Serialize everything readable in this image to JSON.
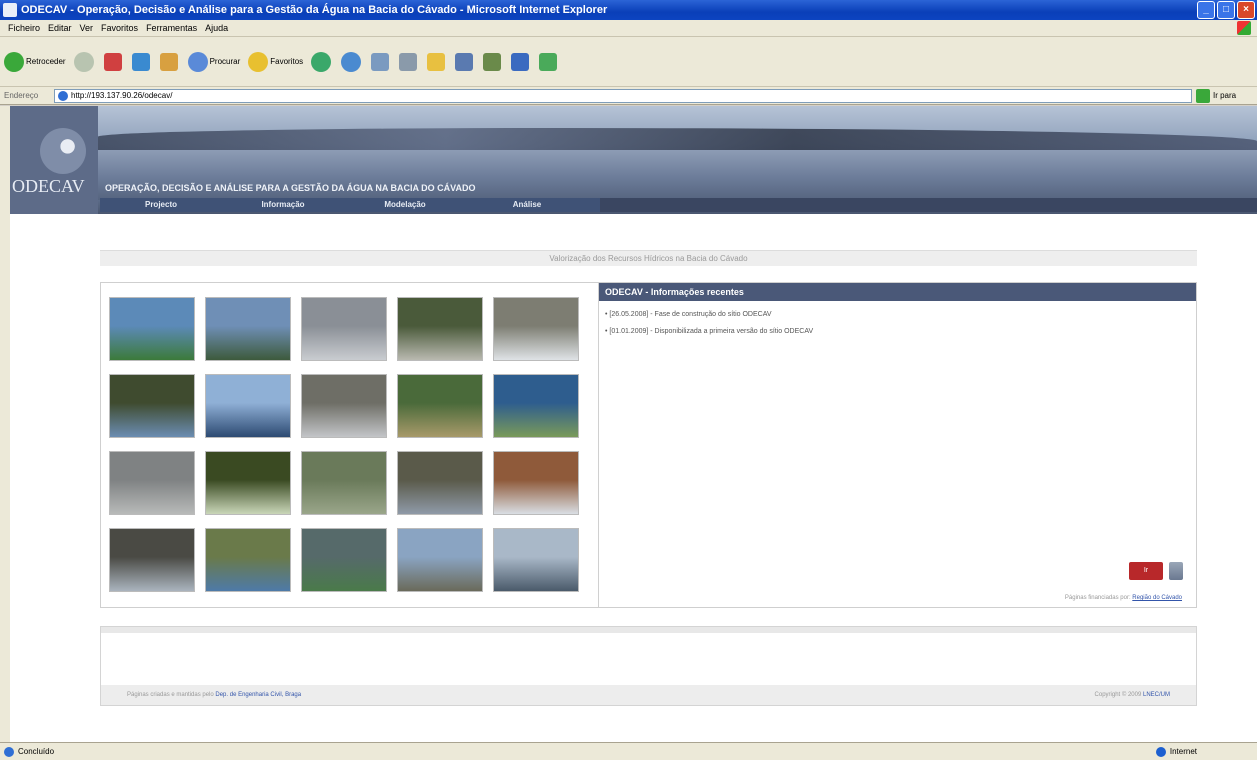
{
  "window": {
    "title": "ODECAV - Operação, Decisão e Análise para a Gestão da Água na Bacia do Cávado - Microsoft Internet Explorer",
    "buttons": [
      "_",
      "□",
      "×"
    ]
  },
  "menu": [
    "Ficheiro",
    "Editar",
    "Ver",
    "Favoritos",
    "Ferramentas",
    "Ajuda"
  ],
  "toolbar": {
    "back_label": "Retroceder",
    "search_label": "Procurar",
    "favorites_label": "Favoritos"
  },
  "address": {
    "label": "Endereço",
    "url": "http://193.137.90.26/odecav/",
    "go_label": "Ir para"
  },
  "site": {
    "logo_text": "ODECAV",
    "tagline": "OPERAÇÃO, DECISÃO E ANÁLISE PARA A GESTÃO DA ÁGUA NA BACIA DO CÁVADO",
    "nav": [
      "Projecto",
      "Informação",
      "Modelação",
      "Análise"
    ],
    "subtitle": "Valorização dos Recursos Hídricos na Bacia do Cávado"
  },
  "news": {
    "header": "ODECAV - Informações recentes",
    "items": [
      "• [26.05.2008] - Fase de construção do sítio ODECAV",
      "• [01.01.2009] - Disponibilizada a primeira versão do sítio ODECAV"
    ],
    "button_label": "Ir",
    "footer_prefix": "Páginas financiadas por:",
    "footer_link": "Região do Cávado"
  },
  "footer": {
    "left_text": "Páginas criadas e mantidas pelo",
    "left_link": "Dep. de Engenharia Civil, Braga",
    "right_text": "Copyright © 2009",
    "right_link": "LNEC/UM"
  },
  "status": {
    "left": "Concluído",
    "zone": "Internet"
  },
  "thumb_colors": [
    [
      "#5c8ab8",
      "#3c7a3a"
    ],
    [
      "#6f8fb6",
      "#3d5a3c"
    ],
    [
      "#8a8f96",
      "#c9ccd0"
    ],
    [
      "#4a5a3a",
      "#b9b9b0"
    ],
    [
      "#7d7d72",
      "#dfe3e6"
    ],
    [
      "#3f4b2f",
      "#6b8db2"
    ],
    [
      "#8fb0d6",
      "#2d4a72"
    ],
    [
      "#6e6e66",
      "#c3c5c8"
    ],
    [
      "#4a6a3a",
      "#a89a6a"
    ],
    [
      "#2e5d8e",
      "#7a9a5a"
    ],
    [
      "#7f8283",
      "#b8bab9"
    ],
    [
      "#3a4a22",
      "#c9d6b8"
    ],
    [
      "#6a7a5a",
      "#9aa68a"
    ],
    [
      "#5a5a4a",
      "#8f9aa8"
    ],
    [
      "#8f5a3a",
      "#d9dee3"
    ],
    [
      "#4a4a44",
      "#aab4be"
    ],
    [
      "#6a7a4a",
      "#4e7aa8"
    ],
    [
      "#566a6a",
      "#4a7a4a"
    ],
    [
      "#8aa4c2",
      "#6a6a5a"
    ],
    [
      "#a9b8c8",
      "#4a5a6a"
    ]
  ]
}
